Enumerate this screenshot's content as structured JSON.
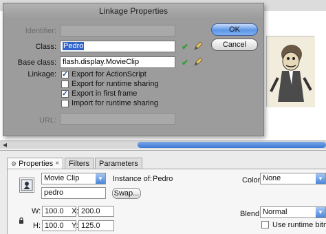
{
  "dialog": {
    "title": "Linkage Properties",
    "identifier_label": "Identifier:",
    "identifier_value": "",
    "class_label": "Class:",
    "class_value": "Pedro",
    "base_class_label": "Base class:",
    "base_class_value": "flash.display.MovieClip",
    "linkage_label": "Linkage:",
    "options": [
      {
        "label": "Export for ActionScript",
        "checked": true
      },
      {
        "label": "Export for runtime sharing",
        "checked": false
      },
      {
        "label": "Export in first frame",
        "checked": true
      },
      {
        "label": "Import for runtime sharing",
        "checked": false
      }
    ],
    "url_label": "URL:",
    "url_value": "",
    "ok_label": "OK",
    "cancel_label": "Cancel",
    "checkmark_glyph": "✔"
  },
  "panel": {
    "tabs": [
      {
        "label": "Properties",
        "close": "×"
      },
      {
        "label": "Filters"
      },
      {
        "label": "Parameters"
      }
    ],
    "symbol_type": "Movie Clip",
    "instance_of_label": "Instance of:",
    "instance_of_value": "Pedro",
    "instance_name": "pedro",
    "swap_label": "Swap...",
    "color_label": "Color:",
    "color_value": "None",
    "blend_label": "Blend:",
    "blend_value": "Normal",
    "runtime_bitmap_label": "Use runtime bitmap",
    "w_label": "W:",
    "w_value": "100.0",
    "h_label": "H:",
    "h_value": "100.0",
    "x_label": "X:",
    "x_value": "200.0",
    "y_label": "Y:",
    "y_value": "125.0"
  },
  "colors": {
    "dialog_bg": "#9c9c9c",
    "ok_blue": "#5c96e6",
    "selection": "#3263c9",
    "valid_check": "#2f9e2f"
  }
}
